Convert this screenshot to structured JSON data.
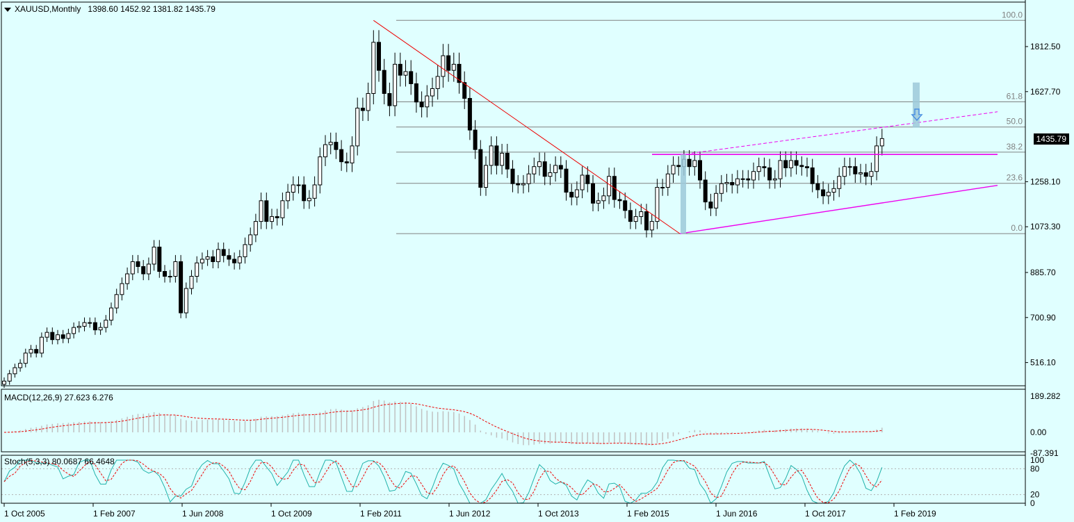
{
  "header": {
    "symbol": "XAUUSD,Monthly",
    "ohlc": "1398.60 1452.92 1381.82 1435.79",
    "last_price": "1435.79"
  },
  "panels": {
    "macd_label": "MACD(12,26,9) 27.623 6.276",
    "stoch_label": "Stoch(5,3,3) 80.0687 66.4648"
  },
  "axes": {
    "price_ticks": [
      "1812.50",
      "1627.70",
      "1258.10",
      "1073.30",
      "885.70",
      "700.90",
      "516.10"
    ],
    "macd_ticks": [
      "189.282",
      "0.00",
      "-87.391"
    ],
    "stoch_ticks": [
      "100",
      "80",
      "20",
      "0"
    ],
    "time_ticks": [
      "1 Oct 2005",
      "1 Feb 2007",
      "1 Jun 2008",
      "1 Oct 2009",
      "1 Feb 2011",
      "1 Jun 2012",
      "1 Oct 2013",
      "1 Feb 2015",
      "1 Jun 2016",
      "1 Oct 2017",
      "1 Feb 2019"
    ]
  },
  "fibonacci": {
    "high_price": 1920,
    "low_price": 1045,
    "labels": [
      "100.0",
      "61.8",
      "50.0",
      "38.2",
      "23.6",
      "0.0"
    ],
    "levels": [
      1.0,
      0.618,
      0.5,
      0.382,
      0.236,
      0.0
    ]
  },
  "colors": {
    "background": "#e0ffff",
    "bull": "#ffffff",
    "bear": "#000000",
    "trendline": "#ee0000",
    "channel": "#ee00ee",
    "fib": "#808080",
    "macd_hist": "#c0c0c0",
    "macd_signal": "#ee0000",
    "stoch_main": "#20b2aa",
    "stoch_signal": "#ee0000",
    "target_bar": "#9cc9d9",
    "arrow": "#4a90e2"
  },
  "chart_data": {
    "type": "candlestick",
    "title": "XAUUSD,Monthly",
    "start": "2005-08",
    "interval": "1 month",
    "series_close": [
      440,
      470,
      495,
      513,
      555,
      570,
      555,
      620,
      640,
      610,
      630,
      615,
      635,
      660,
      665,
      680,
      680,
      650,
      660,
      690,
      740,
      795,
      840,
      880,
      930,
      910,
      880,
      920,
      990,
      890,
      870,
      870,
      930,
      720,
      820,
      870,
      925,
      940,
      950,
      930,
      980,
      955,
      940,
      925,
      950,
      1000,
      1040,
      1095,
      1180,
      1095,
      1115,
      1110,
      1180,
      1215,
      1245,
      1245,
      1180,
      1190,
      1245,
      1360,
      1410,
      1420,
      1390,
      1340,
      1335,
      1405,
      1560,
      1550,
      1620,
      1830,
      1715,
      1620,
      1570,
      1740,
      1695,
      1710,
      1660,
      1585,
      1565,
      1610,
      1640,
      1690,
      1775,
      1715,
      1740,
      1665,
      1600,
      1470,
      1390,
      1235,
      1325,
      1405,
      1325,
      1375,
      1310,
      1250,
      1245,
      1250,
      1290,
      1320,
      1340,
      1280,
      1295,
      1325,
      1310,
      1215,
      1195,
      1225,
      1285,
      1250,
      1170,
      1180,
      1200,
      1280,
      1185,
      1180,
      1140,
      1095,
      1115,
      1135,
      1060,
      1095,
      1235,
      1235,
      1290,
      1325,
      1320,
      1350,
      1320,
      1345,
      1265,
      1175,
      1150,
      1210,
      1250,
      1255,
      1245,
      1270,
      1270,
      1265,
      1300,
      1320,
      1315,
      1265,
      1270,
      1345,
      1315,
      1345,
      1325,
      1320,
      1315,
      1250,
      1225,
      1200,
      1215,
      1230,
      1280,
      1320,
      1320,
      1290,
      1295,
      1280,
      1300,
      1405,
      1435
    ],
    "price_range": [
      440,
      1920
    ],
    "price_axis": [
      516.1,
      1812.5
    ],
    "macd": {
      "value": 27.623,
      "signal": 6.276,
      "range": [
        -87.391,
        189.282
      ]
    },
    "stochastic": {
      "k": 80.0687,
      "d": 66.4648,
      "range": [
        0,
        100
      ]
    }
  }
}
